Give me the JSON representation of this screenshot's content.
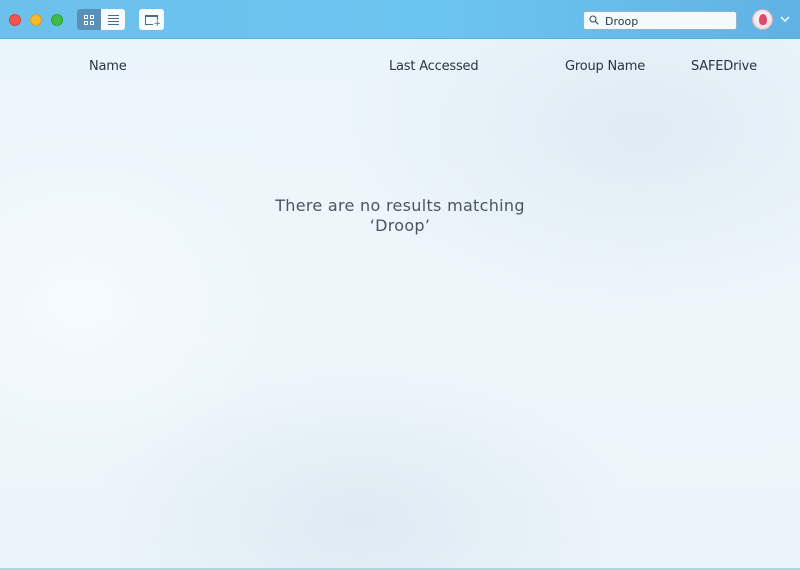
{
  "titlebar": {
    "buttons": {
      "close": "close",
      "minimize": "minimize",
      "maximize": "maximize"
    },
    "view_modes": [
      "grid",
      "list"
    ],
    "selected_view": "grid"
  },
  "search": {
    "value": "Droop",
    "icon": "search-icon"
  },
  "account": {
    "avatar_icon": "avatar",
    "menu_icon": "chevron-down-icon"
  },
  "table": {
    "columns": [
      "Name",
      "Last Accessed",
      "Group Name",
      "SAFEDrive"
    ]
  },
  "empty_state": {
    "line1": "There are no results matching",
    "line2": "‘Droop’"
  },
  "colors": {
    "titlebar": "#6cc1ec",
    "close": "#f0554f",
    "minimize": "#f6b82c",
    "maximize": "#3dbd46",
    "text": "#2a3440"
  }
}
